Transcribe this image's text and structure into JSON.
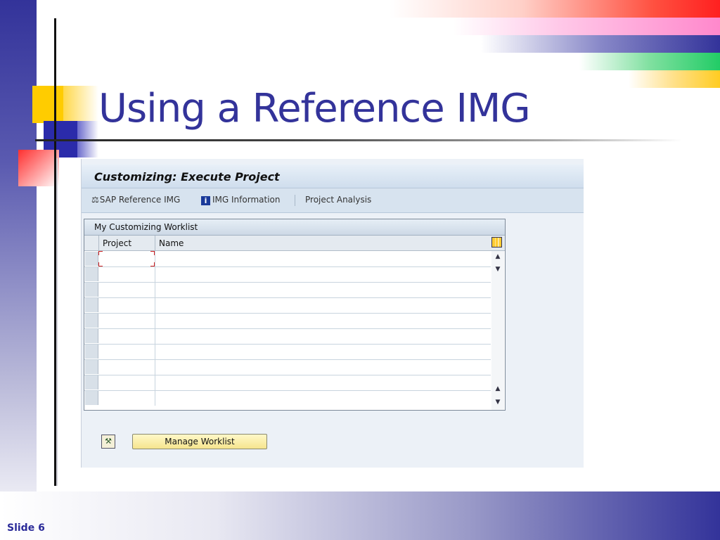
{
  "slide": {
    "title": "Using a Reference IMG",
    "number": "Slide 6"
  },
  "sap": {
    "window_title": "Customizing: Execute Project",
    "toolbar": {
      "reference_img_label": "SAP Reference IMG",
      "img_info_label": "IMG Information",
      "project_analysis_label": "Project Analysis"
    },
    "worklist": {
      "title": "My Customizing Worklist",
      "columns": [
        "Project",
        "Name"
      ],
      "rows": [
        {
          "project": "",
          "name": ""
        },
        {
          "project": "",
          "name": ""
        },
        {
          "project": "",
          "name": ""
        },
        {
          "project": "",
          "name": ""
        },
        {
          "project": "",
          "name": ""
        },
        {
          "project": "",
          "name": ""
        },
        {
          "project": "",
          "name": ""
        },
        {
          "project": "",
          "name": ""
        },
        {
          "project": "",
          "name": ""
        },
        {
          "project": "",
          "name": ""
        }
      ]
    },
    "manage_button_label": "Manage Worklist"
  },
  "colors": {
    "title": "#33339a",
    "accent_yellow": "#ffcc00",
    "accent_blue": "#2b2baa",
    "accent_red": "#ff3030",
    "sap_button": "#f6e58e"
  }
}
